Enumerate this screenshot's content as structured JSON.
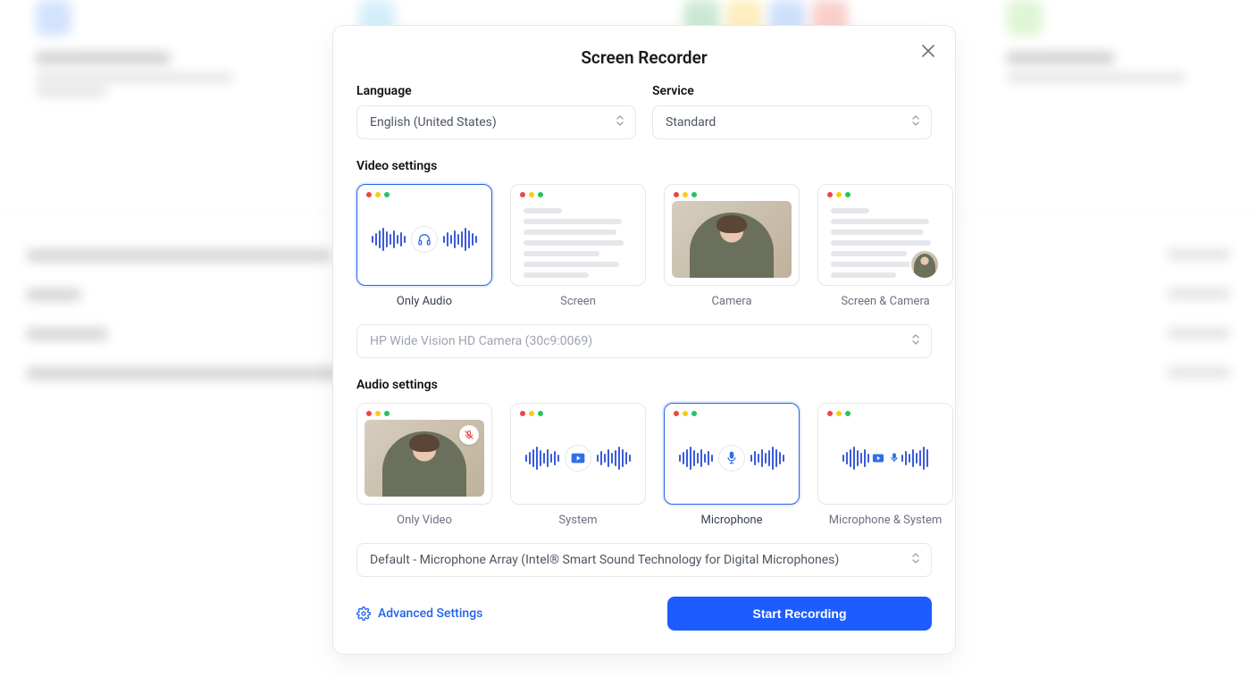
{
  "modal": {
    "title": "Screen Recorder",
    "language_label": "Language",
    "language_value": "English (United States)",
    "service_label": "Service",
    "service_value": "Standard",
    "video_settings_label": "Video settings",
    "video_options": {
      "only_audio": "Only Audio",
      "screen": "Screen",
      "camera": "Camera",
      "screen_camera": "Screen & Camera"
    },
    "camera_select": "HP Wide Vision HD Camera (30c9:0069)",
    "audio_settings_label": "Audio settings",
    "audio_options": {
      "only_video": "Only Video",
      "system": "System",
      "microphone": "Microphone",
      "mic_system": "Microphone & System"
    },
    "mic_select": "Default - Microphone Array (Intel® Smart Sound Technology for Digital Microphones)",
    "advanced_settings": "Advanced Settings",
    "start_recording": "Start Recording"
  }
}
